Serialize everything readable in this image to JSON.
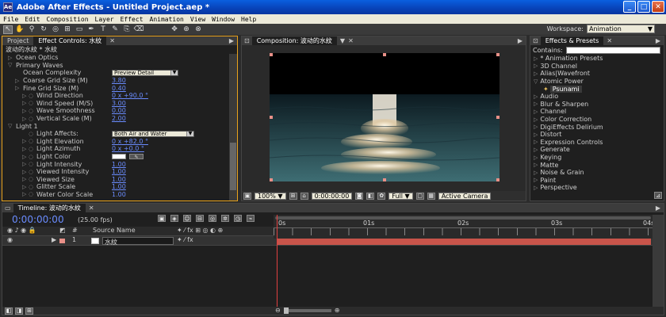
{
  "window": {
    "title": "Adobe After Effects - Untitled Project.aep *",
    "app_icon": "Ae"
  },
  "menu": [
    "File",
    "Edit",
    "Composition",
    "Layer",
    "Effect",
    "Animation",
    "View",
    "Window",
    "Help"
  ],
  "workspace": {
    "label": "Workspace:",
    "value": "Animation"
  },
  "effect_controls": {
    "tabs": [
      "Project",
      "Effect Controls: 水紋"
    ],
    "title": "波动的水紋 * 水紋",
    "rows": [
      {
        "indent": 1,
        "type": "group",
        "label": "Ocean Optics",
        "open": false
      },
      {
        "indent": 1,
        "type": "group",
        "label": "Primary Waves",
        "open": true
      },
      {
        "indent": 2,
        "type": "dropdown",
        "label": "Ocean Complexity",
        "value": "Preview Detail"
      },
      {
        "indent": 2,
        "type": "value",
        "label": "Coarse Grid Size (M)",
        "value": "3.80"
      },
      {
        "indent": 2,
        "type": "value",
        "label": "Fine Grid Size (M)",
        "value": "0.40"
      },
      {
        "indent": 3,
        "type": "value",
        "label": "Wind Direction",
        "value": "0 x +90.0 °"
      },
      {
        "indent": 3,
        "type": "value",
        "label": "Wind Speed (M/S)",
        "value": "3.00"
      },
      {
        "indent": 3,
        "type": "value",
        "label": "Wave Smoothness",
        "value": "0.00"
      },
      {
        "indent": 3,
        "type": "value",
        "label": "Vertical Scale (M)",
        "value": "2.00"
      },
      {
        "indent": 1,
        "type": "group",
        "label": "Light 1",
        "open": true
      },
      {
        "indent": 3,
        "type": "dropdown",
        "label": "Light Affects:",
        "value": "Both Air and Water"
      },
      {
        "indent": 3,
        "type": "value",
        "label": "Light Elevation",
        "value": "0 x +82.0 °"
      },
      {
        "indent": 3,
        "type": "value",
        "label": "Light Azimuth",
        "value": "0 x +0.0 °"
      },
      {
        "indent": 3,
        "type": "color",
        "label": "Light Color",
        "value": ""
      },
      {
        "indent": 3,
        "type": "value",
        "label": "Light Intensity",
        "value": "1.00"
      },
      {
        "indent": 3,
        "type": "value",
        "label": "Viewed Intensity",
        "value": "1.00"
      },
      {
        "indent": 3,
        "type": "value",
        "label": "Viewed Size",
        "value": "1.00"
      },
      {
        "indent": 3,
        "type": "value",
        "label": "Glitter Scale",
        "value": "1.00"
      },
      {
        "indent": 3,
        "type": "value",
        "label": "Water Color Scale",
        "value": "1.00"
      }
    ]
  },
  "composition": {
    "tab": "Composition: 波动的水紋",
    "zoom": "100%",
    "timecode": "0:00:00:00",
    "resolution": "Full",
    "camera": "Active Camera"
  },
  "effects_presets": {
    "tab": "Effects & Presets",
    "contains_label": "Contains:",
    "items": [
      {
        "label": "* Animation Presets",
        "open": false
      },
      {
        "label": "3D Channel",
        "open": false
      },
      {
        "label": "Alias|Wavefront",
        "open": false
      },
      {
        "label": "Atomic Power",
        "open": true
      },
      {
        "label": "Psunami",
        "child": true
      },
      {
        "label": "Audio",
        "open": false
      },
      {
        "label": "Blur & Sharpen",
        "open": false
      },
      {
        "label": "Channel",
        "open": false
      },
      {
        "label": "Color Correction",
        "open": false
      },
      {
        "label": "DigiEffects Delirium",
        "open": false
      },
      {
        "label": "Distort",
        "open": false
      },
      {
        "label": "Expression Controls",
        "open": false
      },
      {
        "label": "Generate",
        "open": false
      },
      {
        "label": "Keying",
        "open": false
      },
      {
        "label": "Matte",
        "open": false
      },
      {
        "label": "Noise & Grain",
        "open": false
      },
      {
        "label": "Paint",
        "open": false
      },
      {
        "label": "Perspective",
        "open": false
      }
    ]
  },
  "timeline": {
    "tab": "Timeline: 波动的水紋",
    "timecode": "0:00:00:00",
    "fps": "(25.00 fps)",
    "col_hash": "#",
    "col_source": "Source Name",
    "ruler": [
      "0s",
      "01s",
      "02s",
      "03s",
      "04s"
    ],
    "layer": {
      "index": "1",
      "name": "水紋"
    }
  },
  "colors": {
    "accent": "#e8a21c",
    "layer_bar": "#c8544a",
    "link": "#6a8cff"
  }
}
